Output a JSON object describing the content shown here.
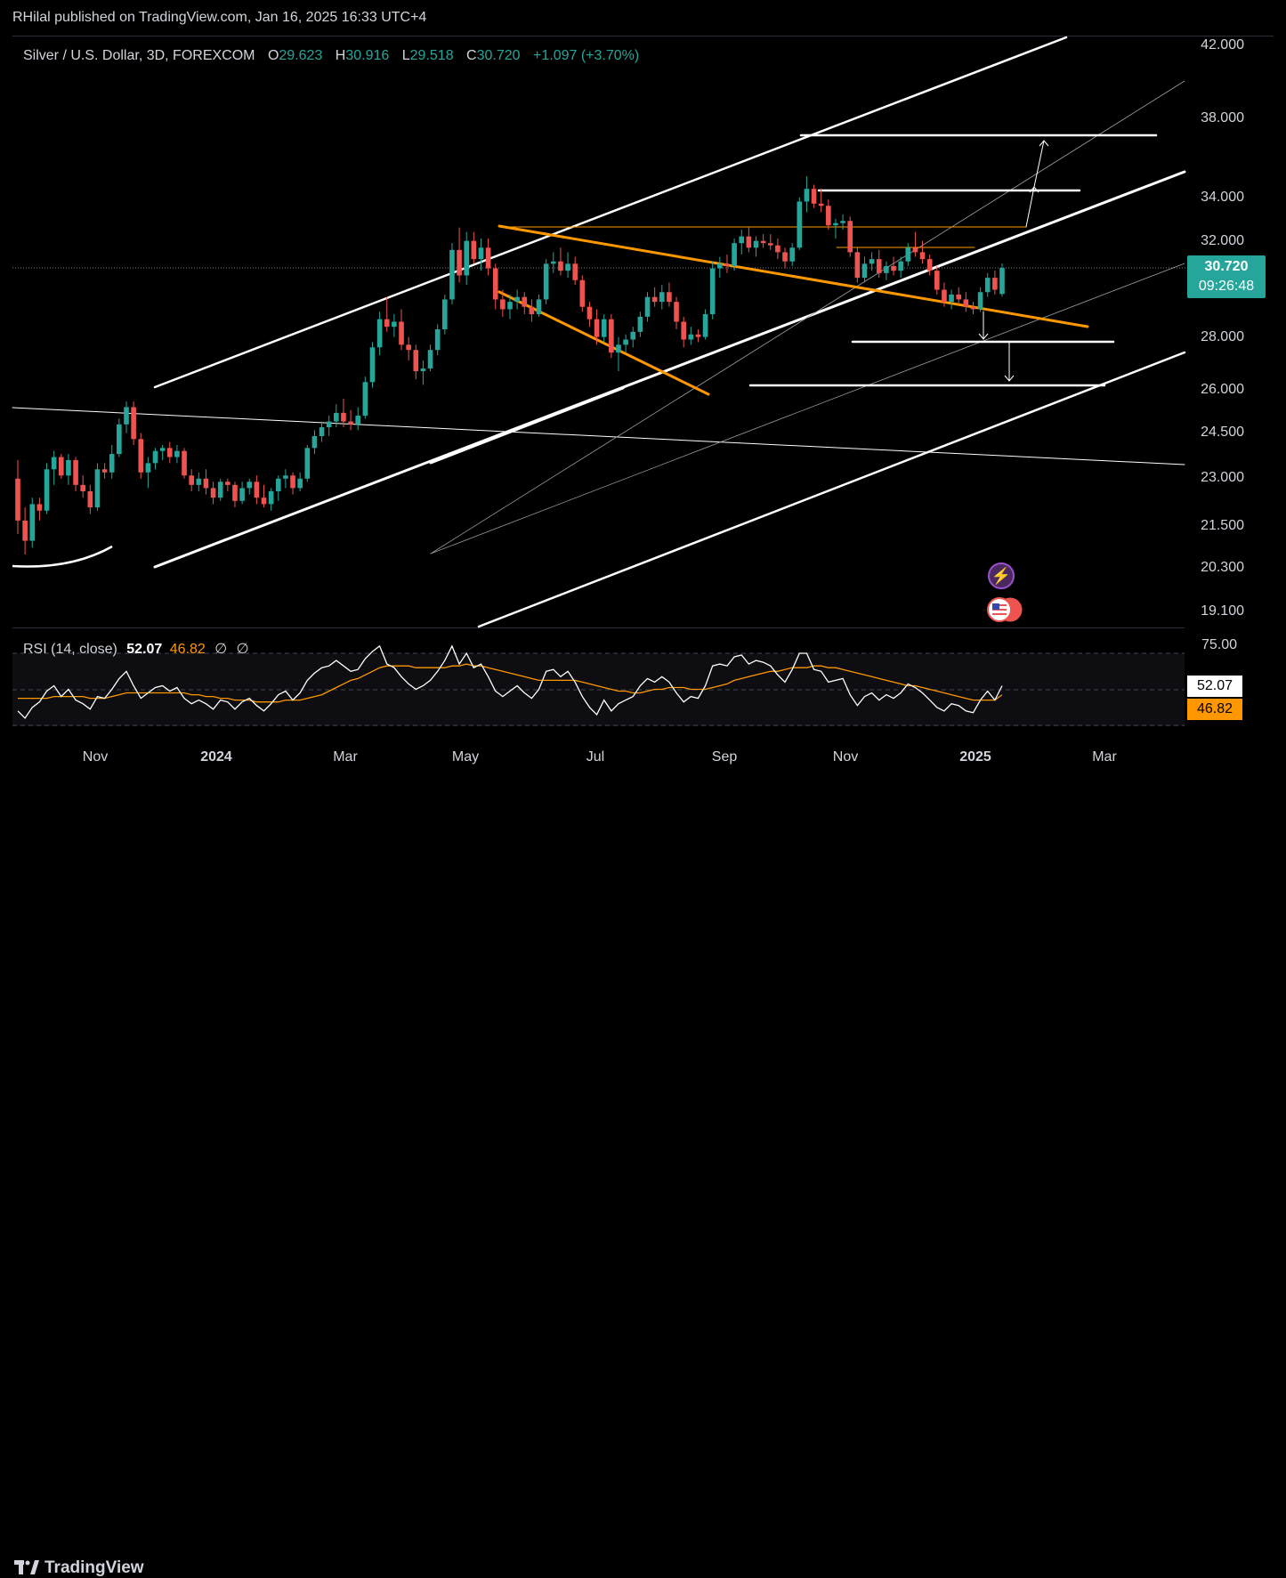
{
  "header": {
    "publisher": "RHilal published on TradingView.com, Jan 16, 2025 16:33 UTC+4"
  },
  "legend": {
    "symbol": "Silver / U.S. Dollar, 3D, FOREXCOM",
    "open_label": "O",
    "open": "29.623",
    "high_label": "H",
    "high": "30.916",
    "low_label": "L",
    "low": "29.518",
    "close_label": "C",
    "close": "30.720",
    "change": "+1.097 (+3.70%)"
  },
  "price_tag": {
    "price": "30.720",
    "countdown": "09:26:48"
  },
  "rsi": {
    "label": "RSI (14, close)",
    "value": "52.07",
    "ma": "46.82",
    "extra1": "∅",
    "extra2": "∅",
    "axis_top": "75.00"
  },
  "footer": {
    "brand": "TradingView"
  },
  "icons": {
    "event": "lightning-icon",
    "flag": "us-flag-icon"
  },
  "colors": {
    "up": "#26a69a",
    "down": "#ef5350",
    "orange": "#ff9800",
    "background": "#000000"
  },
  "chart_data": {
    "type": "candlestick",
    "title": "Silver / U.S. Dollar, 3D, FOREXCOM",
    "y_ticks": [
      "42.000",
      "38.000",
      "34.000",
      "32.000",
      "28.000",
      "26.000",
      "24.500",
      "23.000",
      "21.500",
      "20.300",
      "19.100"
    ],
    "x_ticks": [
      "Nov",
      "2024",
      "Mar",
      "May",
      "Jul",
      "Sep",
      "Nov",
      "2025",
      "Mar"
    ],
    "y_scale": "log",
    "ylim": [
      18.5,
      43.0
    ],
    "series": [
      {
        "name": "Silver / U.S. Dollar",
        "type": "candlestick",
        "points": [
          [
            22.9,
            23.5,
            21.2,
            21.6
          ],
          [
            21.6,
            22.0,
            20.6,
            21.0
          ],
          [
            21.0,
            22.3,
            20.8,
            22.1
          ],
          [
            22.1,
            22.3,
            21.6,
            21.9
          ],
          [
            21.9,
            23.4,
            21.8,
            23.2
          ],
          [
            23.2,
            23.8,
            22.7,
            23.6
          ],
          [
            23.6,
            23.7,
            22.9,
            23.0
          ],
          [
            23.0,
            23.7,
            22.7,
            23.5
          ],
          [
            23.5,
            23.6,
            22.5,
            22.7
          ],
          [
            22.7,
            23.0,
            22.3,
            22.5
          ],
          [
            22.5,
            22.7,
            21.8,
            22.0
          ],
          [
            22.0,
            23.4,
            21.9,
            23.2
          ],
          [
            23.2,
            23.4,
            22.9,
            23.1
          ],
          [
            23.1,
            24.0,
            22.9,
            23.7
          ],
          [
            23.7,
            24.9,
            23.6,
            24.7
          ],
          [
            24.7,
            25.5,
            24.4,
            25.3
          ],
          [
            25.3,
            25.5,
            24.0,
            24.2
          ],
          [
            24.2,
            24.4,
            22.9,
            23.1
          ],
          [
            23.1,
            23.6,
            22.6,
            23.4
          ],
          [
            23.4,
            23.9,
            23.2,
            23.8
          ],
          [
            23.8,
            24.0,
            23.5,
            23.9
          ],
          [
            23.9,
            24.1,
            23.4,
            23.6
          ],
          [
            23.6,
            24.0,
            23.4,
            23.8
          ],
          [
            23.8,
            23.9,
            22.9,
            23.0
          ],
          [
            23.0,
            23.2,
            22.5,
            22.7
          ],
          [
            22.7,
            23.1,
            22.5,
            22.9
          ],
          [
            22.9,
            23.2,
            22.4,
            22.6
          ],
          [
            22.6,
            22.8,
            22.1,
            22.3
          ],
          [
            22.3,
            22.9,
            22.2,
            22.8
          ],
          [
            22.8,
            22.9,
            22.5,
            22.7
          ],
          [
            22.7,
            22.8,
            22.0,
            22.2
          ],
          [
            22.2,
            22.8,
            22.1,
            22.6
          ],
          [
            22.6,
            22.9,
            22.4,
            22.8
          ],
          [
            22.8,
            23.0,
            22.1,
            22.3
          ],
          [
            22.3,
            22.7,
            22.0,
            22.1
          ],
          [
            22.1,
            22.6,
            21.9,
            22.5
          ],
          [
            22.5,
            23.0,
            22.2,
            22.9
          ],
          [
            22.9,
            23.2,
            22.6,
            23.0
          ],
          [
            23.0,
            23.1,
            22.4,
            22.6
          ],
          [
            22.6,
            23.1,
            22.5,
            22.9
          ],
          [
            22.9,
            24.0,
            22.8,
            23.9
          ],
          [
            23.9,
            24.5,
            23.7,
            24.3
          ],
          [
            24.3,
            24.8,
            24.1,
            24.6
          ],
          [
            24.6,
            25.0,
            24.3,
            24.8
          ],
          [
            24.8,
            25.4,
            24.6,
            25.1
          ],
          [
            25.1,
            25.6,
            24.6,
            24.8
          ],
          [
            24.8,
            25.2,
            24.5,
            24.7
          ],
          [
            24.7,
            25.3,
            24.5,
            25.0
          ],
          [
            25.0,
            26.4,
            24.9,
            26.2
          ],
          [
            26.2,
            27.7,
            26.0,
            27.5
          ],
          [
            27.5,
            28.9,
            27.2,
            28.6
          ],
          [
            28.6,
            29.5,
            28.1,
            28.3
          ],
          [
            28.3,
            28.8,
            27.9,
            28.5
          ],
          [
            28.5,
            29.0,
            27.4,
            27.6
          ],
          [
            27.6,
            27.9,
            27.0,
            27.4
          ],
          [
            27.4,
            27.6,
            26.3,
            26.6
          ],
          [
            26.6,
            27.0,
            26.1,
            26.7
          ],
          [
            26.7,
            27.6,
            26.6,
            27.4
          ],
          [
            27.4,
            28.4,
            27.2,
            28.2
          ],
          [
            28.2,
            29.6,
            28.0,
            29.4
          ],
          [
            29.4,
            31.8,
            29.2,
            31.5
          ],
          [
            31.5,
            32.5,
            30.1,
            30.4
          ],
          [
            30.4,
            32.3,
            30.0,
            31.9
          ],
          [
            31.9,
            32.3,
            30.9,
            31.1
          ],
          [
            31.1,
            32.0,
            30.6,
            31.6
          ],
          [
            31.6,
            32.0,
            30.4,
            30.7
          ],
          [
            30.7,
            30.9,
            29.0,
            29.4
          ],
          [
            29.4,
            29.8,
            28.7,
            29.0
          ],
          [
            29.0,
            29.6,
            28.6,
            29.3
          ],
          [
            29.3,
            29.8,
            29.0,
            29.5
          ],
          [
            29.5,
            29.7,
            28.8,
            29.1
          ],
          [
            29.1,
            29.4,
            28.5,
            28.8
          ],
          [
            28.8,
            29.6,
            28.7,
            29.4
          ],
          [
            29.4,
            31.1,
            29.2,
            30.9
          ],
          [
            30.9,
            31.4,
            30.5,
            31.0
          ],
          [
            31.0,
            31.6,
            30.4,
            30.6
          ],
          [
            30.6,
            31.4,
            30.3,
            30.9
          ],
          [
            30.9,
            31.2,
            30.0,
            30.2
          ],
          [
            30.2,
            30.4,
            28.9,
            29.1
          ],
          [
            29.1,
            29.3,
            28.3,
            28.6
          ],
          [
            28.6,
            29.0,
            27.6,
            27.9
          ],
          [
            27.9,
            28.8,
            27.7,
            28.6
          ],
          [
            28.6,
            28.8,
            27.1,
            27.3
          ],
          [
            27.3,
            27.9,
            26.6,
            27.6
          ],
          [
            27.6,
            28.0,
            27.3,
            27.8
          ],
          [
            27.8,
            28.3,
            27.5,
            28.1
          ],
          [
            28.1,
            28.9,
            27.9,
            28.7
          ],
          [
            28.7,
            29.7,
            28.5,
            29.5
          ],
          [
            29.5,
            29.9,
            29.1,
            29.3
          ],
          [
            29.3,
            30.0,
            29.0,
            29.7
          ],
          [
            29.7,
            30.1,
            29.1,
            29.3
          ],
          [
            29.3,
            29.5,
            28.2,
            28.5
          ],
          [
            28.5,
            28.7,
            27.5,
            27.8
          ],
          [
            27.8,
            28.3,
            27.6,
            28.0
          ],
          [
            28.0,
            28.2,
            27.7,
            27.9
          ],
          [
            27.9,
            29.0,
            27.8,
            28.8
          ],
          [
            28.8,
            31.0,
            28.6,
            30.7
          ],
          [
            30.7,
            31.2,
            30.3,
            30.9
          ],
          [
            30.9,
            31.3,
            30.5,
            30.8
          ],
          [
            30.8,
            32.0,
            30.6,
            31.8
          ],
          [
            31.8,
            32.4,
            31.3,
            32.1
          ],
          [
            32.1,
            32.5,
            31.4,
            31.6
          ],
          [
            31.6,
            32.1,
            31.2,
            31.9
          ],
          [
            31.9,
            32.2,
            31.6,
            31.8
          ],
          [
            31.8,
            32.2,
            31.5,
            31.7
          ],
          [
            31.7,
            32.0,
            31.1,
            31.4
          ],
          [
            31.4,
            31.6,
            30.7,
            31.0
          ],
          [
            31.0,
            31.8,
            30.8,
            31.6
          ],
          [
            31.6,
            33.9,
            31.5,
            33.7
          ],
          [
            33.7,
            34.9,
            33.2,
            34.3
          ],
          [
            34.3,
            34.5,
            33.4,
            33.6
          ],
          [
            33.6,
            34.3,
            33.2,
            33.5
          ],
          [
            33.5,
            33.8,
            32.4,
            32.6
          ],
          [
            32.6,
            32.9,
            32.0,
            32.7
          ],
          [
            32.7,
            33.1,
            32.4,
            32.8
          ],
          [
            32.8,
            33.0,
            31.2,
            31.4
          ],
          [
            31.4,
            31.6,
            30.1,
            30.3
          ],
          [
            30.3,
            31.2,
            30.1,
            30.9
          ],
          [
            30.9,
            31.4,
            30.6,
            31.1
          ],
          [
            31.1,
            31.5,
            30.3,
            30.5
          ],
          [
            30.5,
            31.0,
            30.2,
            30.8
          ],
          [
            30.8,
            31.2,
            30.4,
            30.6
          ],
          [
            30.6,
            31.2,
            30.3,
            31.0
          ],
          [
            31.0,
            31.8,
            30.8,
            31.6
          ],
          [
            31.6,
            32.3,
            31.2,
            31.4
          ],
          [
            31.4,
            31.9,
            30.9,
            31.1
          ],
          [
            31.1,
            31.3,
            30.4,
            30.6
          ],
          [
            30.6,
            30.8,
            29.6,
            29.8
          ],
          [
            29.8,
            30.1,
            29.1,
            29.3
          ],
          [
            29.3,
            29.8,
            29.0,
            29.6
          ],
          [
            29.6,
            29.9,
            29.2,
            29.4
          ],
          [
            29.4,
            29.7,
            28.9,
            29.1
          ],
          [
            29.1,
            29.3,
            28.8,
            29.0
          ],
          [
            29.0,
            29.9,
            28.9,
            29.7
          ],
          [
            29.7,
            30.5,
            29.5,
            30.3
          ],
          [
            30.3,
            30.6,
            29.6,
            29.8
          ],
          [
            29.623,
            30.916,
            29.518,
            30.72
          ]
        ]
      }
    ],
    "rsi_series": {
      "name": "RSI (14, close)",
      "ylim": [
        25,
        80
      ],
      "values": [
        38,
        34,
        40,
        43,
        49,
        52,
        46,
        50,
        44,
        42,
        39,
        46,
        45,
        50,
        56,
        60,
        52,
        45,
        48,
        51,
        52,
        49,
        51,
        45,
        42,
        44,
        42,
        39,
        44,
        43,
        39,
        43,
        45,
        41,
        38,
        42,
        47,
        49,
        44,
        48,
        55,
        59,
        62,
        63,
        66,
        63,
        60,
        61,
        67,
        71,
        74,
        64,
        62,
        57,
        53,
        50,
        52,
        55,
        60,
        66,
        74,
        64,
        70,
        62,
        64,
        57,
        49,
        46,
        49,
        52,
        48,
        45,
        50,
        60,
        61,
        57,
        60,
        54,
        46,
        40,
        36,
        44,
        38,
        42,
        44,
        46,
        52,
        56,
        54,
        57,
        54,
        48,
        43,
        46,
        45,
        52,
        63,
        64,
        63,
        68,
        69,
        64,
        66,
        65,
        63,
        58,
        54,
        61,
        70,
        70,
        61,
        60,
        54,
        55,
        56,
        47,
        41,
        46,
        48,
        44,
        47,
        45,
        48,
        53,
        51,
        48,
        44,
        40,
        38,
        42,
        41,
        38,
        37,
        44,
        49,
        44,
        52
      ],
      "ma": [
        45,
        45,
        45,
        45,
        45,
        46,
        46,
        46,
        46,
        46,
        45,
        45,
        45,
        46,
        47,
        48,
        48,
        48,
        48,
        48,
        48,
        48,
        48,
        48,
        47,
        47,
        46,
        46,
        45,
        45,
        44,
        44,
        44,
        43,
        43,
        43,
        43,
        44,
        44,
        44,
        45,
        46,
        47,
        49,
        51,
        53,
        55,
        56,
        58,
        60,
        62,
        63,
        63,
        63,
        63,
        62,
        62,
        62,
        62,
        62,
        63,
        63,
        64,
        63,
        63,
        62,
        61,
        60,
        59,
        58,
        57,
        56,
        55,
        55,
        55,
        55,
        55,
        55,
        54,
        53,
        52,
        51,
        50,
        49,
        49,
        48,
        48,
        49,
        50,
        50,
        51,
        51,
        51,
        50,
        50,
        50,
        51,
        52,
        53,
        55,
        56,
        57,
        58,
        59,
        60,
        60,
        61,
        62,
        62,
        62,
        63,
        63,
        62,
        62,
        61,
        60,
        59,
        58,
        57,
        56,
        55,
        54,
        53,
        52,
        52,
        51,
        50,
        49,
        48,
        47,
        46,
        45,
        44,
        44,
        44,
        44,
        47
      ]
    },
    "drawings": {
      "channel_color": "#ffffff",
      "wedge_color": "#ff9800",
      "grid": false,
      "legend_position": "top-left"
    }
  }
}
